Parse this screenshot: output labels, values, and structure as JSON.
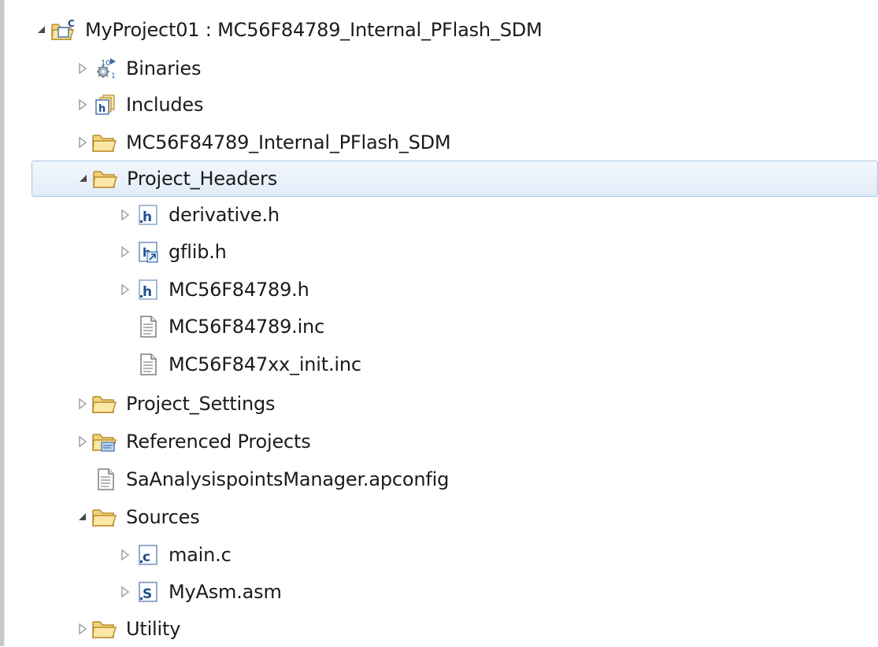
{
  "project": {
    "name": "MyProject01",
    "separator": " : ",
    "build_config": "MC56F84789_Internal_PFlash_SDM"
  },
  "items": {
    "binaries": {
      "label": "Binaries"
    },
    "includes": {
      "label": "Includes"
    },
    "config_folder": {
      "label": "MC56F84789_Internal_PFlash_SDM"
    },
    "project_headers": {
      "label": "Project_Headers"
    },
    "derivative_h": {
      "label": "derivative.h"
    },
    "gflib_h": {
      "label": "gflib.h"
    },
    "mc56f84789_h": {
      "label": "MC56F84789.h"
    },
    "mc56f84789_inc": {
      "label": "MC56F84789.inc"
    },
    "mc56f847xx_init_inc": {
      "label": "MC56F847xx_init.inc"
    },
    "project_settings": {
      "label": "Project_Settings"
    },
    "referenced_projects": {
      "label": "Referenced Projects"
    },
    "apconfig": {
      "label": "SaAnalysispointsManager.apconfig"
    },
    "sources": {
      "label": "Sources"
    },
    "main_c": {
      "label": "main.c"
    },
    "myasm_asm": {
      "label": "MyAsm.asm"
    },
    "utility": {
      "label": "Utility"
    }
  },
  "icons": {
    "expanded": "expanded-arrow-icon",
    "collapsed": "collapsed-arrow-icon",
    "project": "c-project-icon",
    "binaries": "binaries-icon",
    "includes": "includes-icon",
    "folder": "folder-icon",
    "header": "header-file-icon",
    "text": "text-file-icon",
    "c_source": "c-source-file-icon",
    "asm_source": "asm-source-file-icon"
  },
  "colors": {
    "selection_bg": "#e2ecf8",
    "selection_border": "#a7c4e6",
    "folder": "#f4d57a",
    "header_icon": "#2f6fb6"
  }
}
